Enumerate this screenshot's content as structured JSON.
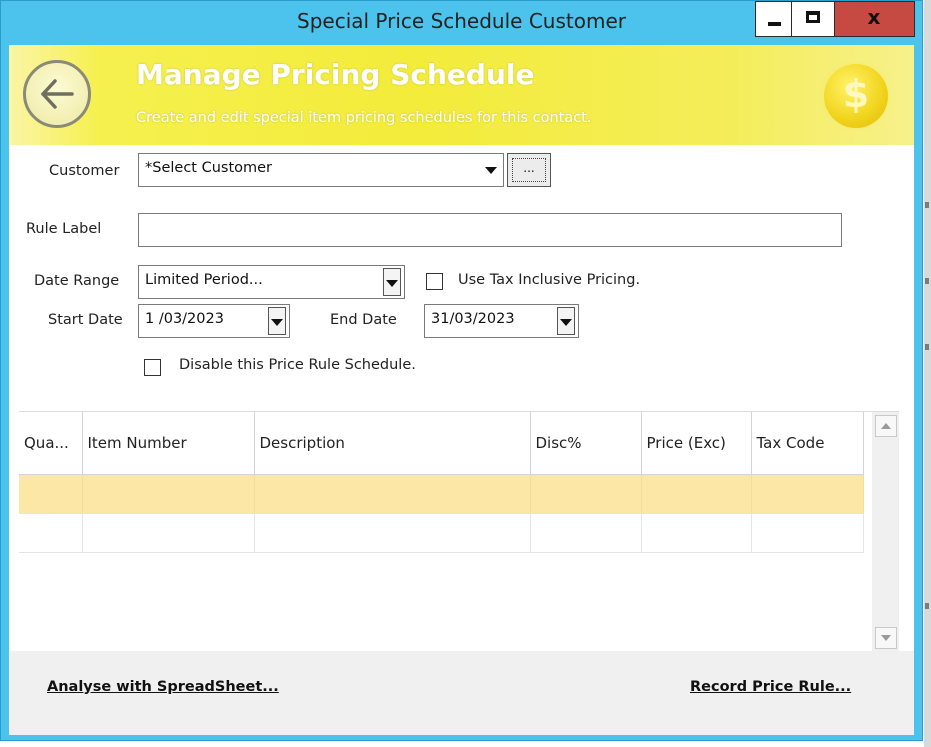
{
  "window": {
    "title": "Special Price Schedule Customer",
    "close_label": "x"
  },
  "banner": {
    "title": "Manage Pricing Schedule",
    "subtitle": "Create and edit special item pricing schedules for this contact.",
    "coin_symbol": "$",
    "accent_color": "#f3ec3a"
  },
  "form": {
    "customer": {
      "label": "Customer",
      "value": "*Select Customer",
      "browse_label": "..."
    },
    "rule_label": {
      "label": "Rule Label",
      "value": ""
    },
    "date_range": {
      "label": "Date Range",
      "value": "Limited Period..."
    },
    "tax_inclusive": {
      "label": "Use Tax Inclusive Pricing.",
      "checked": false
    },
    "start_date": {
      "label": "Start Date",
      "value": "1 /03/2023"
    },
    "end_date": {
      "label": "End Date",
      "value": "31/03/2023"
    },
    "disable_schedule": {
      "label": "Disable this Price Rule Schedule.",
      "checked": false
    }
  },
  "grid": {
    "columns": [
      "Qua...",
      "Item Number",
      "Description",
      "Disc%",
      "Price (Exc)",
      "Tax Code"
    ],
    "rows": [
      [
        "",
        "",
        "",
        "",
        "",
        ""
      ],
      [
        "",
        "",
        "",
        "",
        "",
        ""
      ]
    ],
    "selected_row_color": "#fde7a7"
  },
  "footer": {
    "analyse_link": "Analyse with SpreadSheet...",
    "record_link": "Record Price Rule..."
  }
}
